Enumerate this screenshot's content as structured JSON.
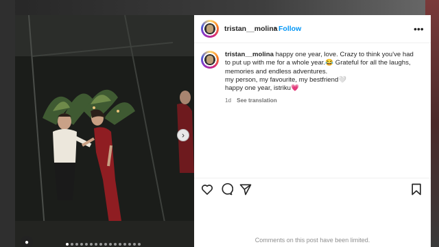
{
  "post": {
    "username": "tristan__molina",
    "separator": "•",
    "follow_label": "Follow",
    "more_icon": "more-horizontal-icon",
    "caption_lines": [
      "happy one year, love. Crazy to think you've had",
      "to put up with me for a whole year.😂 Grateful for all the laughs,",
      "memories and endless adventures.",
      "my person, my favourite, my bestfriend🤍",
      "happy one year, istriku💗"
    ],
    "time_ago": "1d",
    "see_translation": "See translation",
    "comments_limited": "Comments on this post have been limited."
  },
  "carousel": {
    "next_icon": "chevron-right-icon",
    "tag_icon": "user-tag-icon",
    "slide_count": 16,
    "active_index": 0
  },
  "colors": {
    "follow": "#0095f6",
    "text": "#262626",
    "muted": "#737373",
    "dress": "#8f1d22"
  }
}
